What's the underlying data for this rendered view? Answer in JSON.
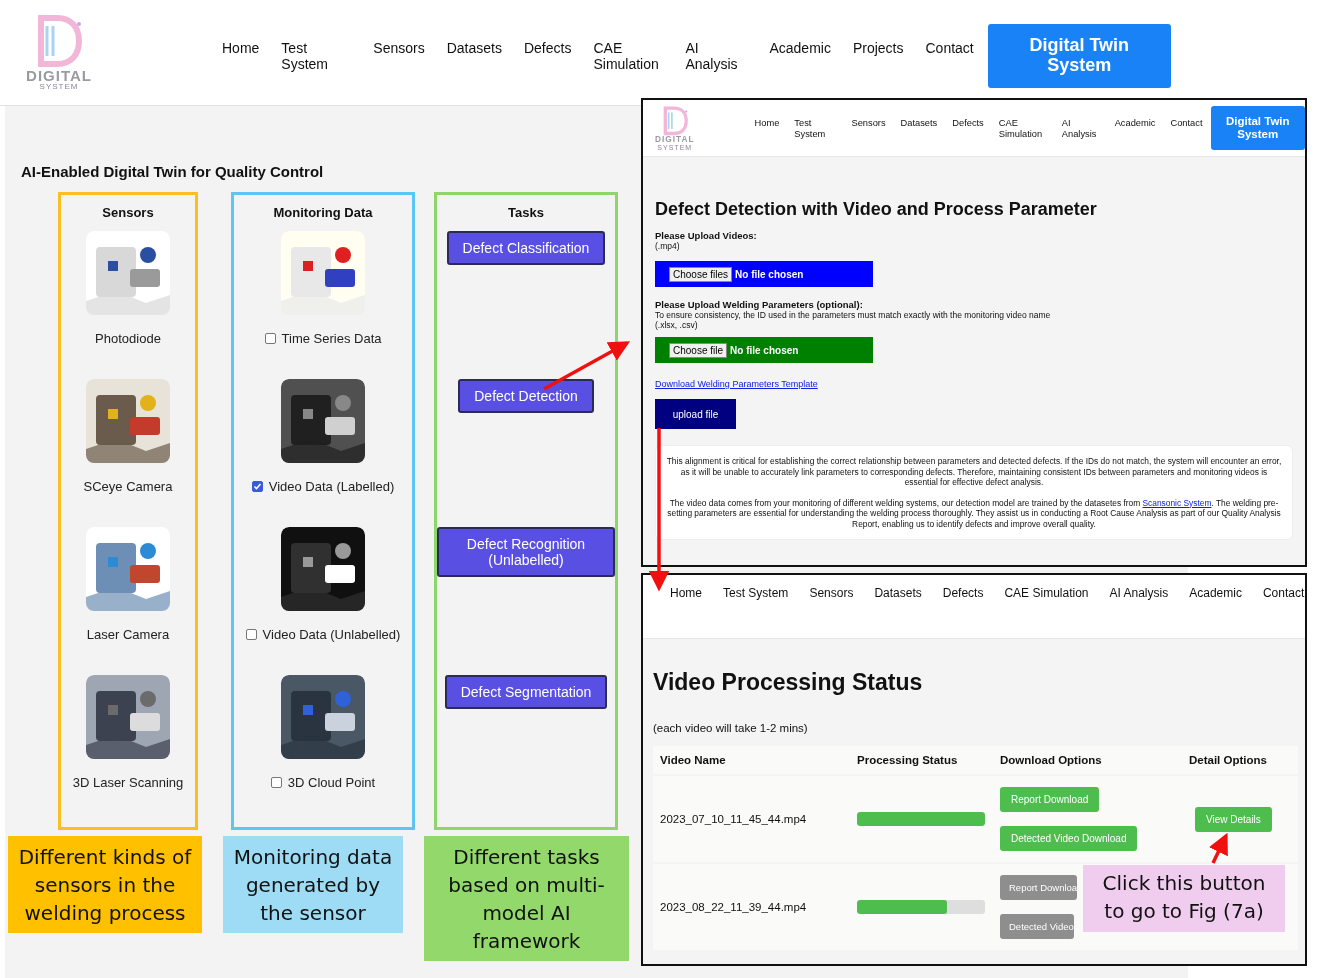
{
  "logo": {
    "word": "DIGITAL",
    "sub": "SYSTEM"
  },
  "nav": [
    "Home",
    "Test System",
    "Sensors",
    "Datasets",
    "Defects",
    "CAE Simulation",
    "AI Analysis",
    "Academic",
    "Projects",
    "Contact"
  ],
  "cta": "Digital Twin System",
  "heading": "AI-Enabled Digital Twin for Quality Control",
  "columns": [
    {
      "kind": "sensors",
      "title": "Sensors",
      "items": [
        {
          "label": "Photodiode"
        },
        {
          "label": "SCeye Camera"
        },
        {
          "label": "Laser Camera"
        },
        {
          "label": "3D Laser Scanning"
        }
      ]
    },
    {
      "kind": "data",
      "title": "Monitoring Data",
      "items": [
        {
          "label": "Time Series Data",
          "checked": false
        },
        {
          "label": "Video Data (Labelled)",
          "checked": true
        },
        {
          "label": "Video Data (Unlabelled)",
          "checked": false
        },
        {
          "label": "3D Cloud Point",
          "checked": false
        }
      ]
    },
    {
      "kind": "tasks",
      "title": "Tasks",
      "items": [
        {
          "label": "Defect Classification"
        },
        {
          "label": "Defect Detection"
        },
        {
          "label": "Defect Recognition (Unlabelled)"
        },
        {
          "label": "Defect Segmentation"
        }
      ]
    }
  ],
  "captions": [
    {
      "text": "Different kinds of sensors in the welding process",
      "color": "#ffc000"
    },
    {
      "text": "Monitoring data generated by the sensor",
      "color": "#9ddcf4"
    },
    {
      "text": "Different tasks based on multi-model AI framework",
      "color": "#92d86b"
    }
  ],
  "detection_page": {
    "logo": {
      "word": "DIGITAL",
      "sub": "SYSTEM"
    },
    "nav": [
      "Home",
      "Test System",
      "Sensors",
      "Datasets",
      "Defects",
      "CAE Simulation",
      "AI Analysis",
      "Academic",
      "Contact"
    ],
    "cta": "Digital Twin System",
    "title": "Defect Detection with Video and Process Parameter",
    "videos_label": "Please Upload Videos:",
    "videos_hint": "(.mp4)",
    "videos_button": "Choose files",
    "videos_status": "No file chosen",
    "params_label": "Please Upload Welding Parameters (optional):",
    "params_note": "To ensure consistency, the ID used in the parameters must match exactly with the monitoring video name",
    "params_hint": "(.xlsx, .csv)",
    "params_button": "Choose file",
    "params_status": "No file chosen",
    "template_link": "Download Welding Parameters Template",
    "upload_button": "upload file",
    "info_1": "This alignment is critical for establishing the correct relationship between parameters and detected defects. If the IDs do not match, the system will encounter an error, as it will be unable to accurately link parameters to corresponding defects. Therefore, maintaining consistent IDs between parameters and monitoring videos is essential for effective defect analysis.",
    "info_2_before": "The video data comes from your monitoring of different welding systems, our detection model are trained by the datasetes from",
    "info_2_link": "Scansonic System",
    "info_2_after": ". The welding pre-setting parameters are essential for understanding the welding process thoroughly. They assist us in conducting a Root Cause Analysis as part of our Quality Analysis Report, enabling us to identify defects and improve overall quality."
  },
  "status_page": {
    "nav": [
      "Home",
      "Test System",
      "Sensors",
      "Datasets",
      "Defects",
      "CAE Simulation",
      "AI Analysis",
      "Academic",
      "Contact"
    ],
    "title": "Video Processing Status",
    "note": "(each video will take 1-2 mins)",
    "columns": [
      "Video Name",
      "Processing Status",
      "Download Options",
      "Detail Options"
    ],
    "rows": [
      {
        "name": "2023_07_10_11_45_44.mp4",
        "level": 1.0,
        "downloads": [
          {
            "label": "Report Download",
            "disabled": false
          },
          {
            "label": "Detected Video Download",
            "disabled": false
          }
        ],
        "detail": "View Details"
      },
      {
        "name": "2023_08_22_11_39_44.mp4",
        "level": 0.7,
        "downloads": [
          {
            "label": "Report Downloa",
            "disabled": true
          },
          {
            "label": "Detected Video",
            "disabled": true
          }
        ]
      }
    ]
  },
  "callout": {
    "text": "Click this button to go to Fig (7a)",
    "color": "#f0ccee"
  }
}
